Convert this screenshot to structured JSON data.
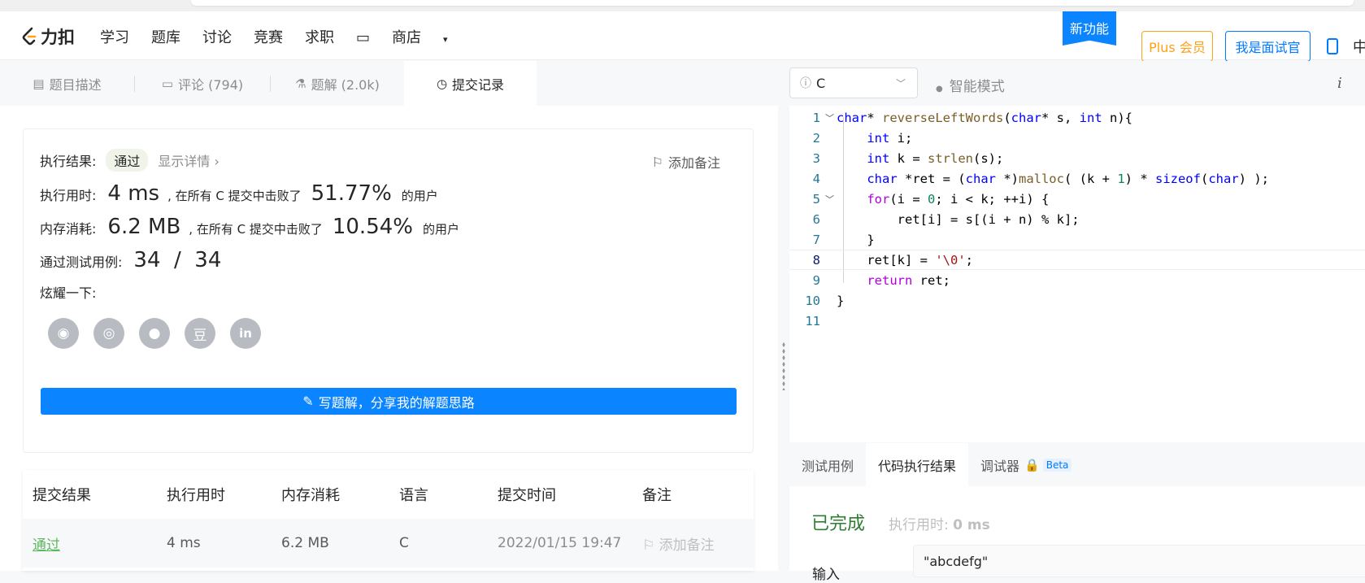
{
  "nav": {
    "logo": "力扣",
    "items": [
      "学习",
      "题库",
      "讨论",
      "竞赛",
      "求职"
    ],
    "shop": "商店",
    "new_feature": "新功能",
    "plus": "Plus 会员",
    "interviewer": "我是面试官",
    "lang": "中"
  },
  "tabs": {
    "description": "题目描述",
    "comments": "评论 (794)",
    "solutions": "题解 (2.0k)",
    "submissions": "提交记录"
  },
  "result": {
    "exec_result_label": "执行结果:",
    "status": "通过",
    "show_detail": "显示详情",
    "add_note": "添加备注",
    "time_label": "执行用时:",
    "time_value": "4 ms",
    "beat_text": ", 在所有 C 提交中击败了",
    "time_pct": "51.77%",
    "users": "的用户",
    "mem_label": "内存消耗:",
    "mem_value": "6.2 MB",
    "mem_pct": "10.54%",
    "tests_label": "通过测试用例:",
    "tests_value": "34  /  34",
    "share_label": "炫耀一下:",
    "write_solution": "写题解，分享我的解题思路"
  },
  "submissions_table": {
    "headers": [
      "提交结果",
      "执行用时",
      "内存消耗",
      "语言",
      "提交时间",
      "备注"
    ],
    "rows": [
      {
        "result": "通过",
        "time": "4 ms",
        "memory": "6.2 MB",
        "lang": "C",
        "submitted": "2022/01/15 19:47",
        "note": "添加备注"
      }
    ]
  },
  "editor": {
    "language": "C",
    "smart_mode": "智能模式",
    "info": "i"
  },
  "console": {
    "tabs": [
      "测试用例",
      "代码执行结果",
      "调试器"
    ],
    "beta": "Beta",
    "status": "已完成",
    "exec_time_label": "执行用时:",
    "exec_time_value": "0 ms",
    "input_label": "输入",
    "input_value": "\"abcdefg\""
  },
  "colors": {
    "accent_blue": "#0a84ff",
    "plus_orange": "#ffa116",
    "pass_green": "#5cb85c"
  }
}
